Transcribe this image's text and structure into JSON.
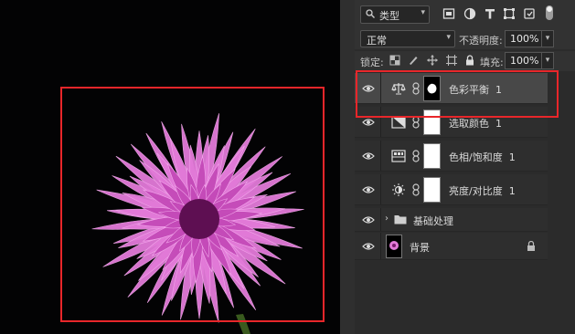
{
  "panel": {
    "kind_filter": "类型",
    "blend_mode": "正常",
    "opacity_label": "不透明度:",
    "opacity_value": "100%",
    "lock_label": "锁定:",
    "fill_label": "填充:",
    "fill_value": "100%"
  },
  "layers": [
    {
      "name": "色彩平衡",
      "badge": "1",
      "type": "color-balance-adjustment",
      "selected": true,
      "mask": "black-with-white-blob"
    },
    {
      "name": "选取颜色",
      "badge": "1",
      "type": "selective-color-adjustment",
      "selected": false,
      "mask": "white"
    },
    {
      "name": "色相/饱和度",
      "badge": "1",
      "type": "hue-saturation-adjustment",
      "selected": false,
      "mask": "white"
    },
    {
      "name": "亮度/对比度",
      "badge": "1",
      "type": "brightness-contrast-adjustment",
      "selected": false,
      "mask": "white"
    },
    {
      "name": "基础处理",
      "type": "group",
      "collapsed": true
    },
    {
      "name": "背景",
      "type": "background",
      "locked": true
    }
  ],
  "colors": {
    "annotation": "#e8262a",
    "flower": "#e060d8",
    "panel_bg": "#2b2b2b",
    "selected_row": "#484848"
  }
}
